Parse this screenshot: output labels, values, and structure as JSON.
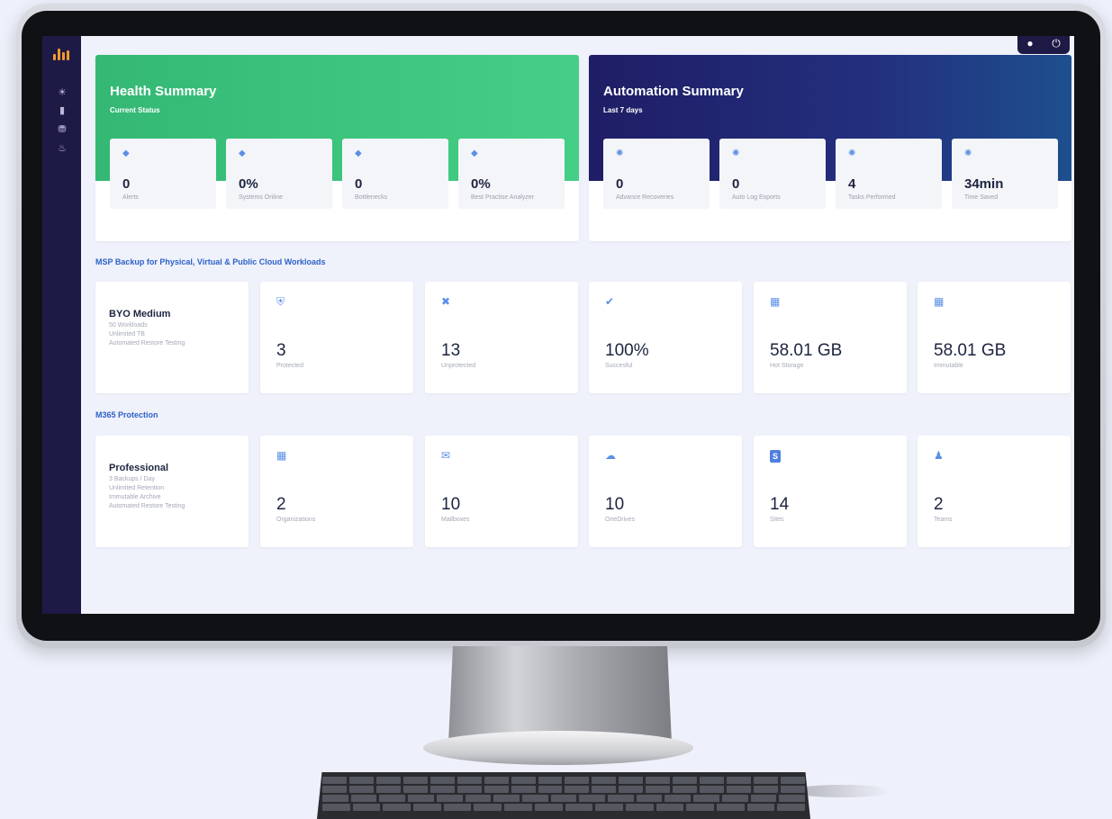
{
  "colors": {
    "health_band": "#3cc27c",
    "automation_band": "#24266f",
    "sidebar": "#1e1a46",
    "accent_blue": "#2d62c9",
    "icon_blue": "#5b8fe6"
  },
  "sidebar": {
    "logo": "bar-logo",
    "items": [
      {
        "icon": "sun-icon"
      },
      {
        "icon": "bar-chart-icon"
      },
      {
        "icon": "bank-icon"
      },
      {
        "icon": "bell-icon"
      }
    ]
  },
  "topbar": {
    "icons": [
      "user-icon",
      "power-icon"
    ]
  },
  "health": {
    "title": "Health Summary",
    "subtitle": "Current Status",
    "stats": [
      {
        "value": "0",
        "label": "Alerts"
      },
      {
        "value": "0%",
        "label": "Systems Online"
      },
      {
        "value": "0",
        "label": "Bottlenecks"
      },
      {
        "value": "0%",
        "label": "Best Practise Analyzer"
      }
    ]
  },
  "automation": {
    "title": "Automation Summary",
    "subtitle": "Last 7 days",
    "stats": [
      {
        "value": "0",
        "label": "Advance Recoveries"
      },
      {
        "value": "0",
        "label": "Auto Log Exports"
      },
      {
        "value": "4",
        "label": "Tasks Performed"
      },
      {
        "value": "34min",
        "label": "Time Saved"
      }
    ]
  },
  "msp": {
    "section_title": "MSP Backup for Physical, Virtual & Public Cloud Workloads",
    "plan": {
      "name": "BYO Medium",
      "details": [
        "50 Workloads",
        "Unlimited TB",
        "Automated Restore Testing"
      ]
    },
    "stats": [
      {
        "icon": "shield-check-icon",
        "value": "3",
        "label": "Protected"
      },
      {
        "icon": "shield-x-icon",
        "value": "13",
        "label": "Unprotected"
      },
      {
        "icon": "check-circle-icon",
        "value": "100%",
        "label": "Succesful"
      },
      {
        "icon": "storage-icon",
        "value": "58.01 GB",
        "label": "Hot Storage"
      },
      {
        "icon": "storage-icon",
        "value": "58.01 GB",
        "label": "Immutable"
      }
    ]
  },
  "m365": {
    "section_title": "M365 Protection",
    "plan": {
      "name": "Professional",
      "details": [
        "3 Backups / Day",
        "Unlimited Retention",
        "Immutable Archive",
        "Automated Restore Testing"
      ]
    },
    "stats": [
      {
        "icon": "windows-icon",
        "value": "2",
        "label": "Organizations"
      },
      {
        "icon": "mail-icon",
        "value": "10",
        "label": "Mailboxes"
      },
      {
        "icon": "cloud-icon",
        "value": "10",
        "label": "OneDrives"
      },
      {
        "icon": "sharepoint-icon",
        "value": "14",
        "label": "Sites"
      },
      {
        "icon": "teams-icon",
        "value": "2",
        "label": "Teams"
      }
    ]
  }
}
